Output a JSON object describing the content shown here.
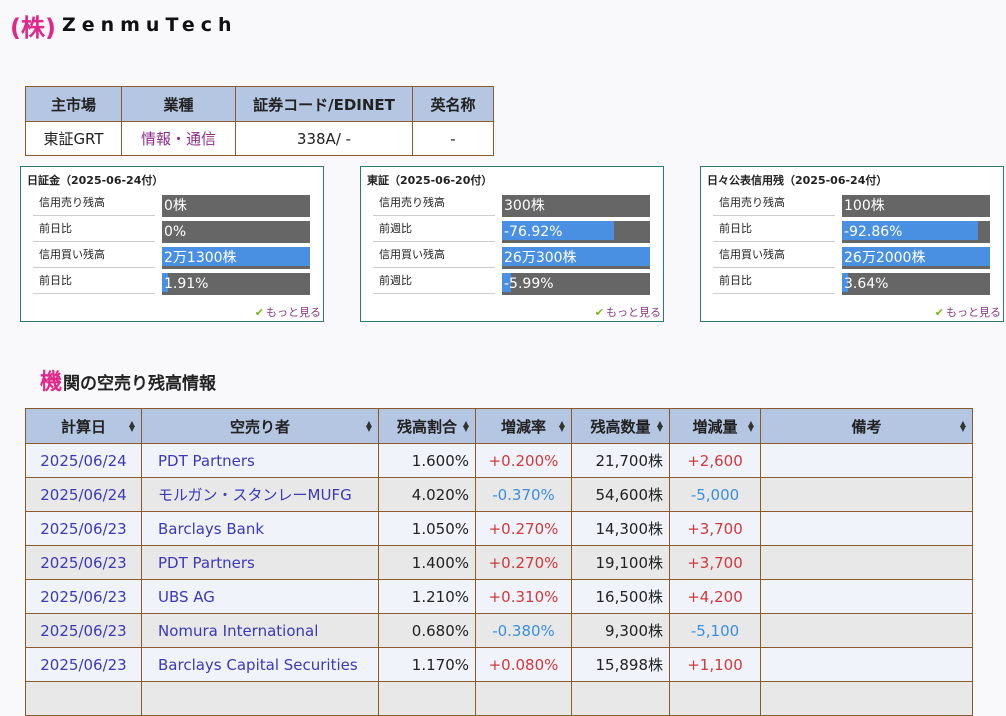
{
  "logo": {
    "kabu": "(株)",
    "name": "ZenmuTech"
  },
  "info": {
    "headers": [
      "主市場",
      "業種",
      "証券コード/EDINET",
      "英名称"
    ],
    "values": [
      "東証GRT",
      "情報・通信",
      "338A/ -",
      "-"
    ]
  },
  "boxes": [
    {
      "title": "日証金（2025-06-24付）",
      "rows": [
        {
          "label": "信用売り残高",
          "value": "0株",
          "fill": 0
        },
        {
          "label": "前日比",
          "value": "0%",
          "fill": 0
        },
        {
          "label": "信用買い残高",
          "value": "2万1300株",
          "fill": 100
        },
        {
          "label": "前日比",
          "value": "1.91%",
          "fill": 4
        }
      ],
      "more": "もっと見る"
    },
    {
      "title": "東証（2025-06-20付）",
      "rows": [
        {
          "label": "信用売り残高",
          "value": "300株",
          "fill": 0
        },
        {
          "label": "前週比",
          "value": "-76.92%",
          "fill": 76
        },
        {
          "label": "信用買い残高",
          "value": "26万300株",
          "fill": 100
        },
        {
          "label": "前週比",
          "value": "-5.99%",
          "fill": 6
        }
      ],
      "more": "もっと見る"
    },
    {
      "title": "日々公表信用残（2025-06-24付）",
      "rows": [
        {
          "label": "信用売り残高",
          "value": "100株",
          "fill": 0
        },
        {
          "label": "前日比",
          "value": "-92.86%",
          "fill": 92
        },
        {
          "label": "信用買い残高",
          "value": "26万2000株",
          "fill": 100
        },
        {
          "label": "前日比",
          "value": "3.64%",
          "fill": 4
        }
      ],
      "more": "もっと見る"
    }
  ],
  "section": {
    "first": "機",
    "rest": "関の空売り残高情報"
  },
  "short_table": {
    "headers": [
      "計算日",
      "空売り者",
      "残高割合",
      "増減率",
      "残高数量",
      "増減量",
      "備考"
    ],
    "rows": [
      [
        "2025/06/24",
        "PDT Partners",
        "1.600%",
        "+0.200%",
        "21,700株",
        "+2,600",
        ""
      ],
      [
        "2025/06/24",
        "モルガン・スタンレーMUFG",
        "4.020%",
        "-0.370%",
        "54,600株",
        "-5,000",
        ""
      ],
      [
        "2025/06/23",
        "Barclays Bank",
        "1.050%",
        "+0.270%",
        "14,300株",
        "+3,700",
        ""
      ],
      [
        "2025/06/23",
        "PDT Partners",
        "1.400%",
        "+0.270%",
        "19,100株",
        "+3,700",
        ""
      ],
      [
        "2025/06/23",
        "UBS AG",
        "1.210%",
        "+0.310%",
        "16,500株",
        "+4,200",
        ""
      ],
      [
        "2025/06/23",
        "Nomura International",
        "0.680%",
        "-0.380%",
        "9,300株",
        "-5,100",
        ""
      ],
      [
        "2025/06/23",
        "Barclays Capital Securities",
        "1.170%",
        "+0.080%",
        "15,898株",
        "+1,100",
        ""
      ],
      [
        "",
        "",
        "",
        "",
        "",
        "",
        ""
      ]
    ]
  }
}
